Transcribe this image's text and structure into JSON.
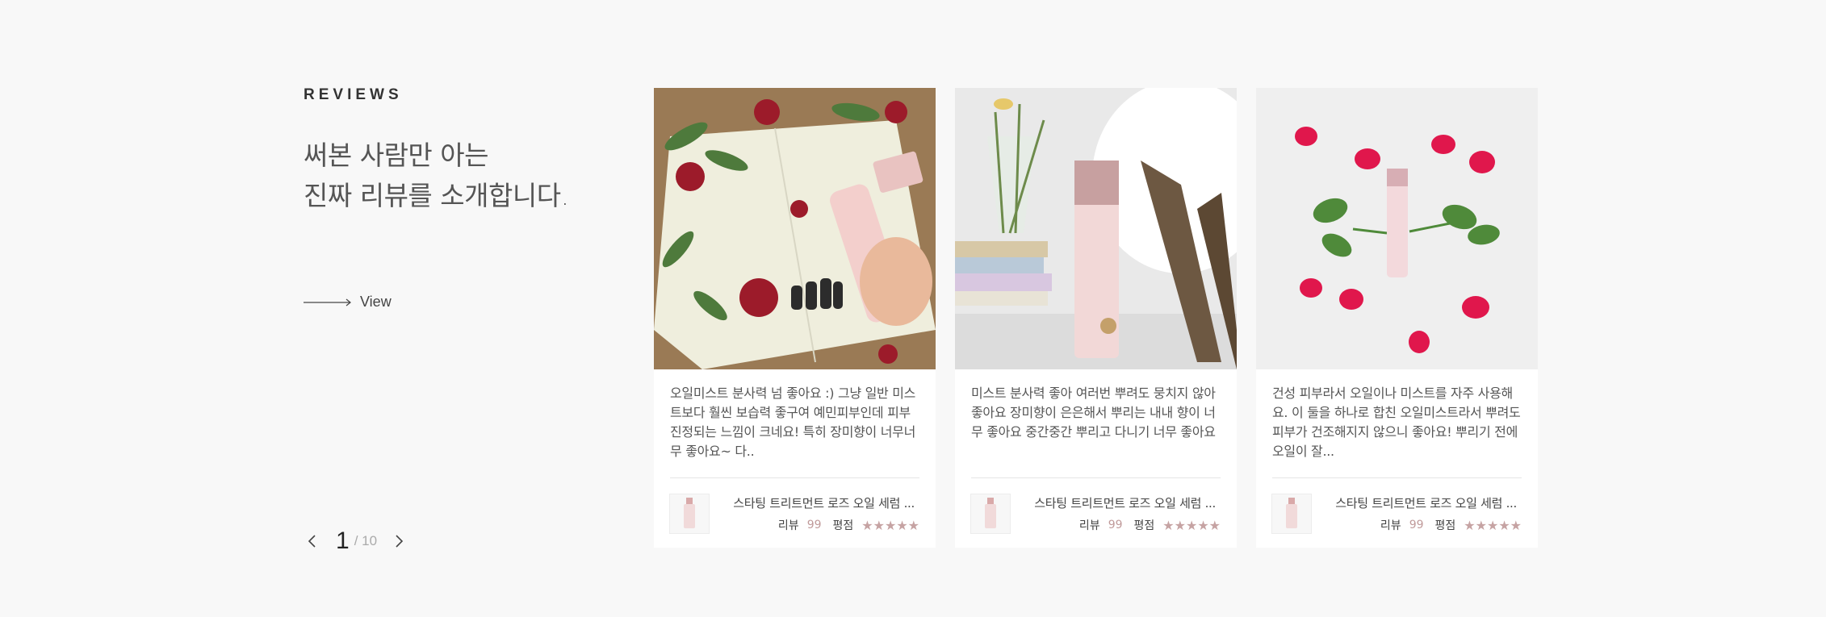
{
  "section": {
    "label": "REVIEWS",
    "headline_line1": "써본 사람만 아는",
    "headline_line2": "진짜 리뷰를 소개합니다.",
    "view_label": "View"
  },
  "pagination": {
    "current": "1",
    "total": "/ 10"
  },
  "reviews": [
    {
      "text": "오일미스트 분사력 넘 좋아요 :) 그냥 일반 미스트보다 훨씬 보습력 좋구여 예민피부인데 피부진정되는 느낌이 크네요! 특히 장미향이 너무너무 좋아요~ 다..",
      "product": "스타팅 트리트먼트 로즈 오일 세럼 ...",
      "review_label": "리뷰",
      "review_count": "99",
      "rating_label": "평점",
      "stars": "★★★★★"
    },
    {
      "text": "미스트 분사력 좋아 여러번 뿌려도 뭉치지 않아 좋아요 장미향이 은은해서 뿌리는 내내 향이 너무 좋아요 중간중간 뿌리고 다니기 너무 좋아요",
      "product": "스타팅 트리트먼트 로즈 오일 세럼 ...",
      "review_label": "리뷰",
      "review_count": "99",
      "rating_label": "평점",
      "stars": "★★★★★"
    },
    {
      "text": "건성 피부라서 오일이나 미스트를 자주 사용해요. 이 둘을 하나로 합친 오일미스트라서 뿌려도 피부가 건조해지지 않으니 좋아요! 뿌리기 전에 오일이 잘...",
      "product": "스타팅 트리트먼트 로즈 오일 세럼 ...",
      "review_label": "리뷰",
      "review_count": "99",
      "rating_label": "평점",
      "stars": "★★★★★"
    }
  ],
  "colors": {
    "background": "#f8f8f8",
    "card": "#ffffff",
    "accent_pink": "#c6a3a3",
    "text": "#555555"
  },
  "icons": {
    "view_arrow": "long-arrow-right-icon",
    "prev": "chevron-left-icon",
    "next": "chevron-right-icon"
  }
}
